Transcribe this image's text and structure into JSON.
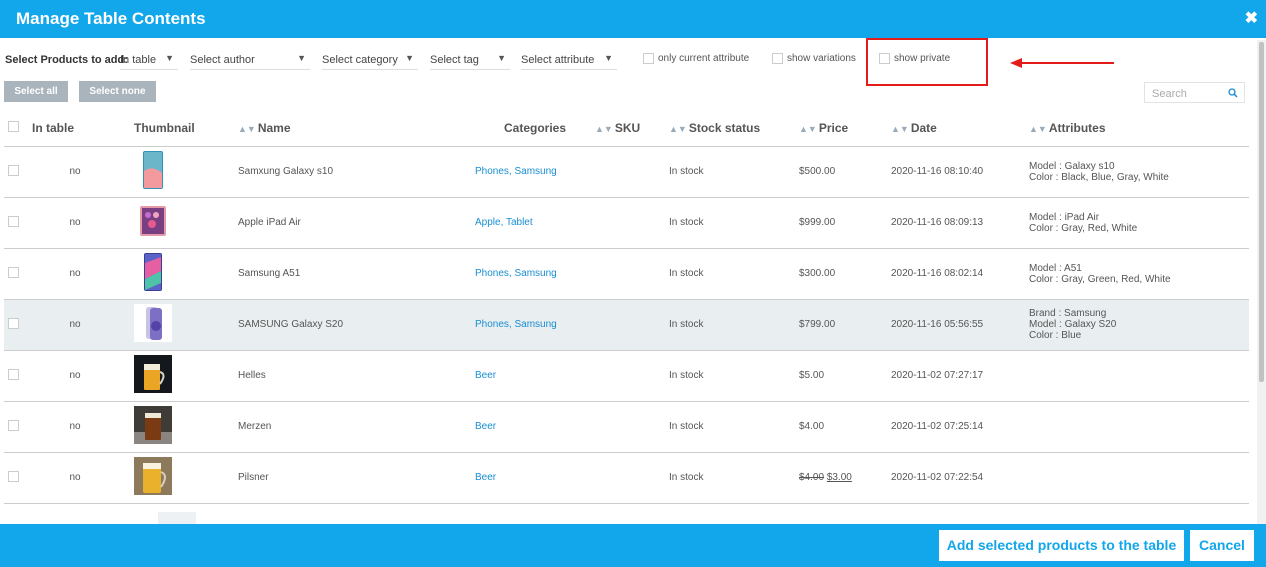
{
  "header": {
    "title": "Manage Table Contents",
    "close_glyph": "✖"
  },
  "filters": {
    "label": "Select Products to add:",
    "in_table": "In table",
    "author": "Select author",
    "category": "Select category",
    "tag": "Select tag",
    "attribute": "Select attribute",
    "only_current_attribute": "only current attribute",
    "show_variations": "show variations",
    "show_private": "show private"
  },
  "buttons": {
    "select_all": "Select all",
    "select_none": "Select none"
  },
  "search": {
    "placeholder": "Search"
  },
  "columns": [
    "In table",
    "Thumbnail",
    "Name",
    "Categories",
    "SKU",
    "Stock status",
    "Price",
    "Date",
    "Attributes"
  ],
  "rows": [
    {
      "in_table": "no",
      "name": "Samxung Galaxy s10",
      "categories": "Phones, Samsung",
      "sku": "",
      "stock": "In stock",
      "price": "$500.00",
      "date": "2020-11-16 08:10:40",
      "attr1": "Model : Galaxy s10",
      "attr2": "Color : Black, Blue, Gray, White",
      "attr3": ""
    },
    {
      "in_table": "no",
      "name": "Apple iPad Air",
      "categories": "Apple, Tablet",
      "sku": "",
      "stock": "In stock",
      "price": "$999.00",
      "date": "2020-11-16 08:09:13",
      "attr1": "Model : iPad Air",
      "attr2": "Color : Gray, Red, White",
      "attr3": ""
    },
    {
      "in_table": "no",
      "name": "Samsung A51",
      "categories": "Phones, Samsung",
      "sku": "",
      "stock": "In stock",
      "price": "$300.00",
      "date": "2020-11-16 08:02:14",
      "attr1": "Model : A51",
      "attr2": "Color : Gray, Green, Red, White",
      "attr3": ""
    },
    {
      "in_table": "no",
      "name": "SAMSUNG Galaxy S20",
      "categories": "Phones, Samsung",
      "sku": "",
      "stock": "In stock",
      "price": "$799.00",
      "date": "2020-11-16 05:56:55",
      "attr1": "Brand : Samsung",
      "attr2": "Model : Galaxy S20",
      "attr3": "Color : Blue"
    },
    {
      "in_table": "no",
      "name": "Helles",
      "categories": "Beer",
      "sku": "",
      "stock": "In stock",
      "price": "$5.00",
      "date": "2020-11-02 07:27:17",
      "attr1": "",
      "attr2": "",
      "attr3": ""
    },
    {
      "in_table": "no",
      "name": "Merzen",
      "categories": "Beer",
      "sku": "",
      "stock": "In stock",
      "price": "$4.00",
      "date": "2020-11-02 07:25:14",
      "attr1": "",
      "attr2": "",
      "attr3": ""
    },
    {
      "in_table": "no",
      "name": "Pilsner",
      "categories": "Beer",
      "sku": "",
      "stock": "In stock",
      "price_old": "$4.00",
      "price": "$3.00",
      "date": "2020-11-02 07:22:54",
      "attr1": "",
      "attr2": "",
      "attr3": ""
    }
  ],
  "footer": {
    "add": "Add selected products to the table",
    "cancel": "Cancel"
  },
  "colors": {
    "accent": "#12a6ea",
    "highlight_red": "#e21b1b",
    "link": "#1a8ed3"
  }
}
